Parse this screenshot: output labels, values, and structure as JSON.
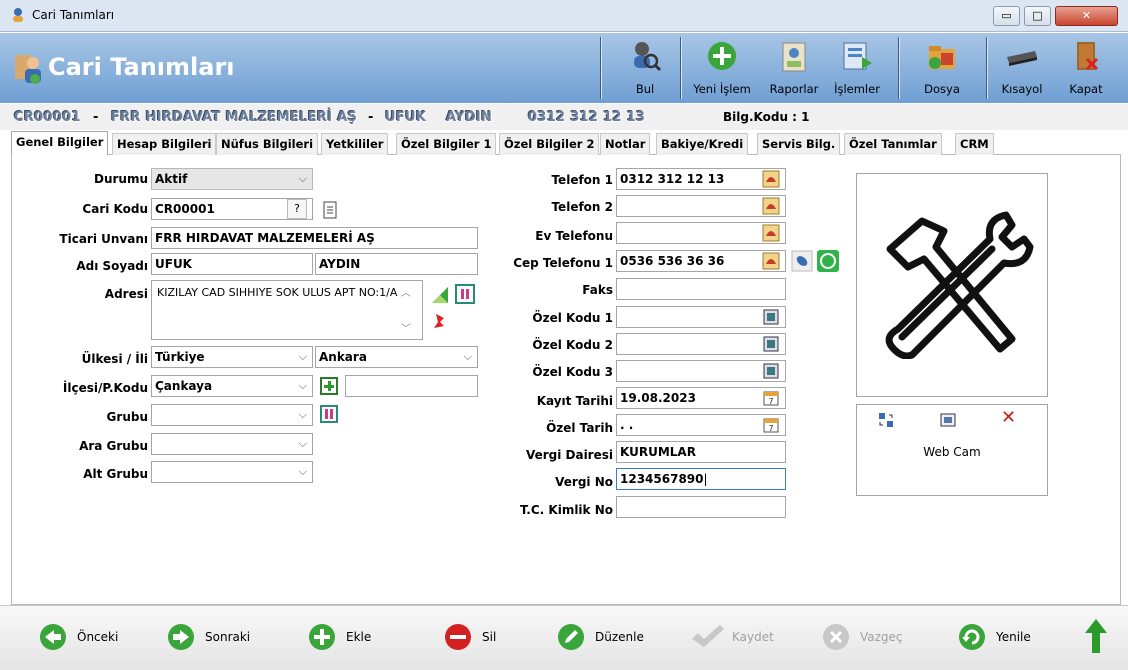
{
  "window": {
    "title": "Cari Tanımları",
    "min": "▭",
    "max": "□",
    "close": "✕"
  },
  "header": {
    "title": "Cari Tanımları"
  },
  "toolbar": {
    "bul": "Bul",
    "yeni_islem": "Yeni İşlem",
    "raporlar": "Raporlar",
    "islemler": "İşlemler",
    "dosya": "Dosya",
    "kisayol": "Kısayol",
    "kapat": "Kapat"
  },
  "info": {
    "code": "CR00001",
    "sep1": "-",
    "company": "FRR HIRDAVAT MALZEMELERİ AŞ",
    "sep2": "-",
    "name": "UFUK",
    "surname": "AYDIN",
    "phone": "0312 312 12 13",
    "bilg": "Bilg.Kodu : 1"
  },
  "tabs": [
    "Genel Bilgiler",
    "Hesap Bilgileri",
    "Nüfus Bilgileri",
    "Yetkililer",
    "Özel Bilgiler 1",
    "Özel Bilgiler 2",
    "Notlar",
    "Bakiye/Kredi",
    "Servis Bilg.",
    "Özel Tanımlar",
    "CRM"
  ],
  "left": {
    "durumu_l": "Durumu",
    "durumu_v": "Aktif",
    "kod_l": "Cari Kodu",
    "kod_v": "CR00001",
    "kod_q": "?",
    "unvan_l": "Ticari Unvanı",
    "unvan_v": "FRR HIRDAVAT MALZEMELERİ AŞ",
    "adsoyad_l": "Adı Soyadı",
    "ad_v": "UFUK",
    "soyad_v": "AYDIN",
    "adres_l": "Adresi",
    "adres_v": "KIZILAY CAD SIHHIYE SOK ULUS APT NO:1/A",
    "ulke_l": "Ülkesi / İli",
    "ulke_v": "Türkiye",
    "il_v": "Ankara",
    "ilce_l": "İlçesi/P.Kodu",
    "ilce_v": "Çankaya",
    "pkod_v": "",
    "grubu_l": "Grubu",
    "ara_l": "Ara Grubu",
    "alt_l": "Alt Grubu"
  },
  "right": {
    "tel1_l": "Telefon 1",
    "tel1_v": "0312 312 12 13",
    "tel2_l": "Telefon 2",
    "evtel_l": "Ev Telefonu",
    "cep_l": "Cep Telefonu 1",
    "cep_v": "0536 536 36 36",
    "faks_l": "Faks",
    "ok1_l": "Özel Kodu 1",
    "ok2_l": "Özel Kodu 2",
    "ok3_l": "Özel Kodu 3",
    "kayit_l": "Kayıt Tarihi",
    "kayit_v": "19.08.2023",
    "ozel_tarih_l": "Özel Tarih",
    "ozel_tarih_v": ". .",
    "vd_l": "Vergi Dairesi",
    "vd_v": "KURUMLAR",
    "vn_l": "Vergi No",
    "vn_v": "1234567890",
    "tc_l": "T.C. Kimlik No"
  },
  "webcam": {
    "label": "Web Cam"
  },
  "bottom": {
    "onceki": "Önceki",
    "sonraki": "Sonraki",
    "ekle": "Ekle",
    "sil": "Sil",
    "duzenle": "Düzenle",
    "kaydet": "Kaydet",
    "vazgec": "Vazgeç",
    "yenile": "Yenile"
  }
}
